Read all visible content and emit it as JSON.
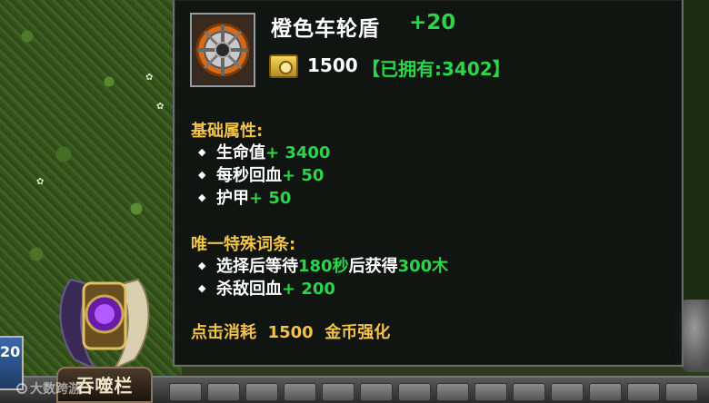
{
  "tooltip": {
    "item_name": "橙色车轮盾",
    "level": "+20",
    "price": "1500",
    "owned": "【已拥有:3402】",
    "base_section": {
      "title": "基础属性:",
      "stats": [
        {
          "label": "生命值",
          "value": "+ 3400"
        },
        {
          "label": "每秒回血",
          "value": "+ 50"
        },
        {
          "label": "护甲",
          "value": "+ 50"
        }
      ]
    },
    "unique_section": {
      "title": "唯一特殊词条:",
      "stats": [
        {
          "pre": "选择后等待",
          "v1": "180秒",
          "mid": "后获得",
          "v2": "300木"
        },
        {
          "label": "杀敌回血",
          "value": "+ 200"
        }
      ]
    },
    "footer": {
      "pre": "点击消耗",
      "amount": "1500",
      "post": "金币强化"
    }
  },
  "hud": {
    "left_value": "20",
    "swallow_label": "吞噬栏"
  },
  "watermark": "大数跨游",
  "colors": {
    "green": "#2cd44a",
    "gold": "#f2c24a",
    "panel_bg": "#0e1210"
  },
  "icons": [
    "shield-item-icon",
    "gold-coin-icon",
    "bullet-diamond-icon",
    "emblem-wing-icon"
  ]
}
